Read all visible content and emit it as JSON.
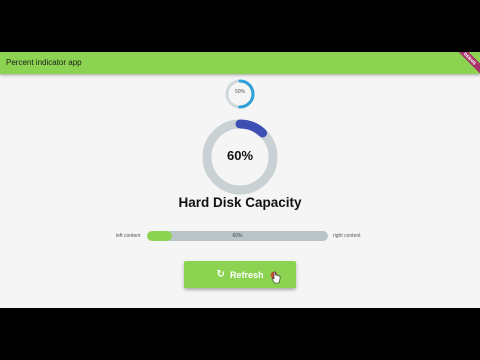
{
  "app": {
    "title": "Percent indicator app",
    "debug_banner": "DEBUG",
    "accent_color": "#8bd351",
    "ring_color": "#3e4fb4",
    "small_ring_color": "#2f9fd9"
  },
  "small_indicator": {
    "label": "50%",
    "percent": 0.5
  },
  "big_indicator": {
    "label": "60%",
    "percent": 0.12
  },
  "heading": "Hard Disk Capacity",
  "linear_indicator": {
    "left_label": "left content",
    "right_label": "right content",
    "center_label": "60%",
    "percent": 0.14
  },
  "refresh_button": {
    "label": "Refresh",
    "icon": "refresh-icon"
  }
}
